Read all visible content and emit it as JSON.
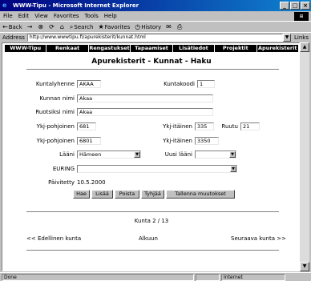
{
  "window": {
    "title": "WWW-Tipu - Microsoft Internet Explorer",
    "min": "_",
    "max": "□",
    "close": "×"
  },
  "menu": [
    "File",
    "Edit",
    "View",
    "Favorites",
    "Tools",
    "Help"
  ],
  "toolbar": {
    "back": "Back",
    "forward": "→",
    "stop": "⊗",
    "refresh": "⟳",
    "home": "⌂",
    "search": "Search",
    "favorites": "Favorites",
    "history": "History"
  },
  "address": {
    "label": "Address",
    "value": "http://www.wwwtipu.fi/apurekisterit/kunnat.html",
    "links": "Links"
  },
  "nav": [
    "WWW-Tipu",
    "Renkaat",
    "Rengastukset",
    "Tapaamiset",
    "Lisätiedot",
    "Projektit",
    "Apurekisterit"
  ],
  "page": {
    "title": "Apurekisterit - Kunnat - Haku",
    "form": {
      "kuntalyhenne_label": "Kuntalyhenne",
      "kuntalyhenne_value": "AKAA",
      "kuntakoodi_label": "Kuntakoodi",
      "kuntakoodi_value": "1",
      "kunnan_nimi_label": "Kunnan nimi",
      "kunnan_nimi_value": "Akaa",
      "ruotsiksi_label": "Ruotsiksi nimi",
      "ruotsiksi_value": "Akaa",
      "ykj_pohjoinen_label": "Ykj-pohjoinen",
      "ykj_pohjoinen_value": "681",
      "ykj_itainen_label": "Ykj-itäinen",
      "ykj_itainen_value": "335",
      "ruutu_label": "Ruutu",
      "ruutu_value": "21",
      "ykj_pohjoinen2_label": "Ykj-pohjoinen",
      "ykj_pohjoinen2_value": "6801",
      "ykj_itainen2_label": "Ykj-itäinen",
      "ykj_itainen2_value": "3350",
      "laani_label": "Lääni",
      "laani_value": "Hämeen",
      "uusi_laani_label": "Uusi lääni",
      "uusi_laani_value": "",
      "euring_label": "EURING",
      "euring_value": "",
      "paivitetty_label": "Päivitetty",
      "paivitetty_value": "10.5.2000"
    },
    "buttons": [
      "Hae",
      "Lisää",
      "Poista",
      "Tyhjää",
      "Tallenna muutokset"
    ],
    "pager": "Kunta 2 / 13",
    "prev": "<< Edellinen kunta",
    "start": "Alkuun",
    "next": "Seuraava kunta >>"
  },
  "status": {
    "done": "Done",
    "zone": "Internet"
  }
}
